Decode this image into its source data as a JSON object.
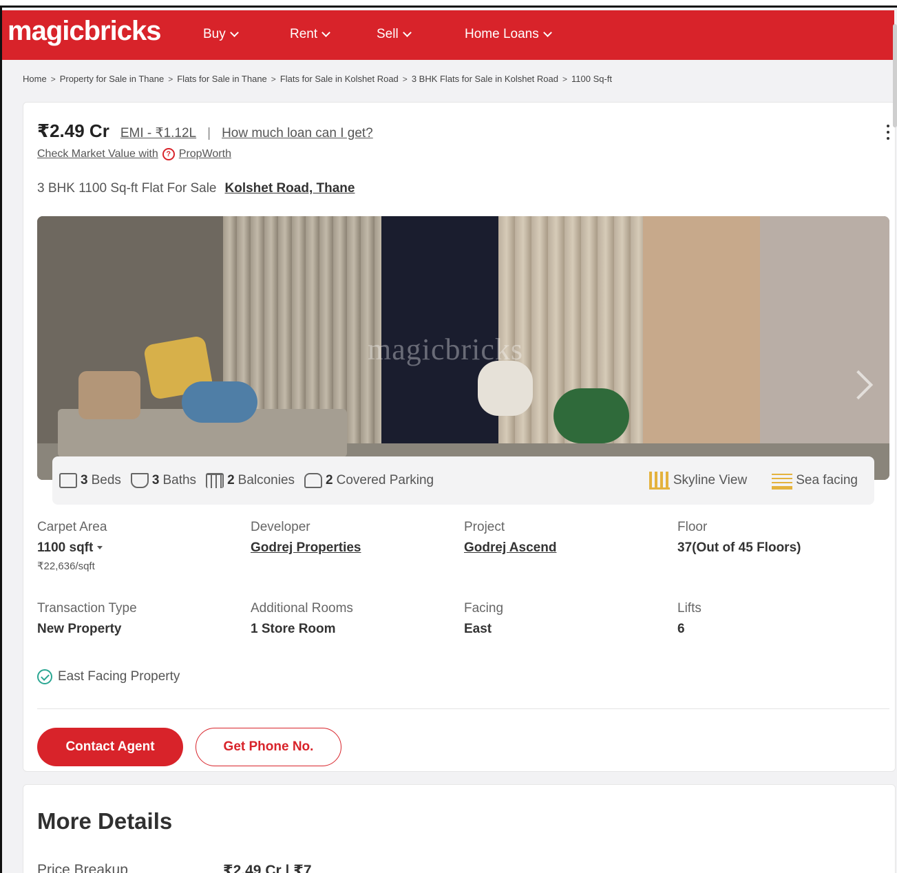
{
  "header": {
    "logo": "magicbricks",
    "nav": [
      {
        "label": "Buy"
      },
      {
        "label": "Rent"
      },
      {
        "label": "Sell"
      },
      {
        "label": "Home Loans"
      }
    ]
  },
  "breadcrumb": [
    "Home",
    "Property for Sale in Thane",
    "Flats for Sale in Thane",
    "Flats for Sale in Kolshet Road",
    "3 BHK Flats for Sale in Kolshet Road",
    "1100 Sq-ft"
  ],
  "listing": {
    "price": "₹2.49 Cr",
    "emi": "EMI - ₹1.12L",
    "separator": "|",
    "loan_link": "How much loan can I get?",
    "market_value_text": "Check Market Value with",
    "propworth": "PropWorth",
    "title": "3 BHK 1100 Sq-ft Flat For Sale",
    "locality": "Kolshet Road, Thane",
    "photo_watermark": "magicbricks",
    "amenities": {
      "beds_count": "3",
      "beds_label": "Beds",
      "baths_count": "3",
      "baths_label": "Baths",
      "balconies_count": "2",
      "balconies_label": "Balconies",
      "parking_count": "2",
      "parking_label": "Covered Parking",
      "view": "Skyline View",
      "sea": "Sea facing"
    },
    "specs": {
      "carpet_area_label": "Carpet Area",
      "carpet_area_value": "1100 sqft",
      "price_per_sqft": "₹22,636/sqft",
      "developer_label": "Developer",
      "developer_value": "Godrej Properties",
      "project_label": "Project",
      "project_value": "Godrej Ascend",
      "floor_label": "Floor",
      "floor_value": "37(Out of 45 Floors)",
      "transaction_label": "Transaction Type",
      "transaction_value": "New Property",
      "rooms_label": "Additional Rooms",
      "rooms_value": "1 Store Room",
      "facing_label": "Facing",
      "facing_value": "East",
      "lifts_label": "Lifts",
      "lifts_value": "6"
    },
    "facing_note": "East Facing Property",
    "contact_button": "Contact Agent",
    "phone_button": "Get Phone No."
  },
  "more_details": {
    "title": "More Details",
    "price_breakup_label": "Price Breakup",
    "price_breakup_value": "₹2.49 Cr | ₹7"
  },
  "colors": {
    "brand_red": "#d8232a",
    "amenity_icon_yellow": "#e2a71e",
    "check_green": "#2aa692"
  }
}
